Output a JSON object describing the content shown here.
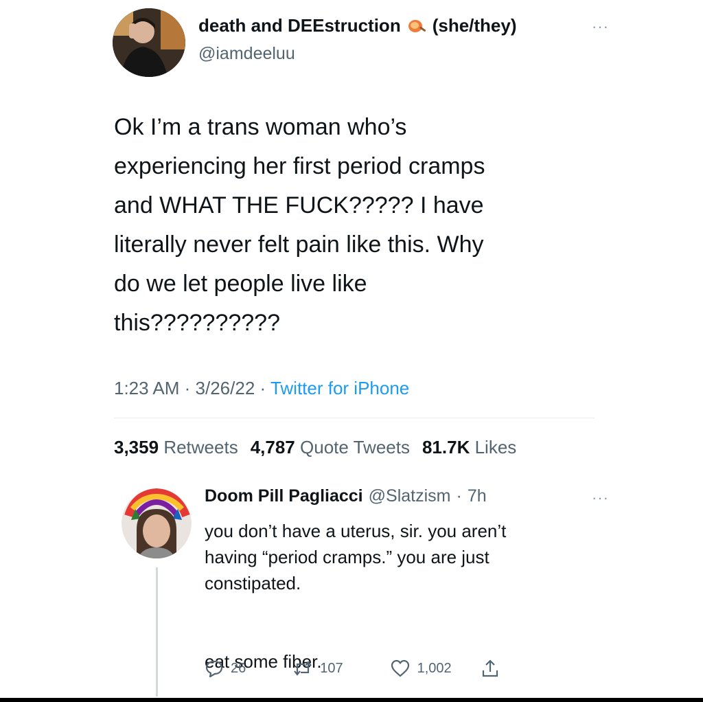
{
  "main_tweet": {
    "display_name": "death and DEEstruction",
    "pronouns": "(she/they)",
    "handle": "@iamdeeluu",
    "more_icon": "ellipsis-icon",
    "text": "Ok I’m a trans woman who’s\nexperiencing her first period cramps\nand WHAT THE FUCK????? I have\nliterally never felt pain like this. Why\ndo we let people live like\nthis??????????",
    "time": "1:23 AM",
    "date": "3/26/22",
    "source": "Twitter for iPhone",
    "retweets_count": "3,359",
    "retweets_label": "Retweets",
    "quote_count": "4,787",
    "quote_label": "Quote Tweets",
    "likes_count": "81.7K",
    "likes_label": "Likes"
  },
  "reply": {
    "display_name": "Doom Pill Pagliacci",
    "handle": "@Slatzism",
    "age": "7h",
    "text": "you don’t have a uterus, sir. you aren’t\nhaving “period cramps.” you are just\nconstipated.\n\n\neat some fiber.",
    "replies": "26",
    "retweets": "107",
    "likes": "1,002"
  },
  "colors": {
    "link_blue": "#1d9bf0",
    "secondary_text": "#536471",
    "primary_text": "#0f1419"
  }
}
